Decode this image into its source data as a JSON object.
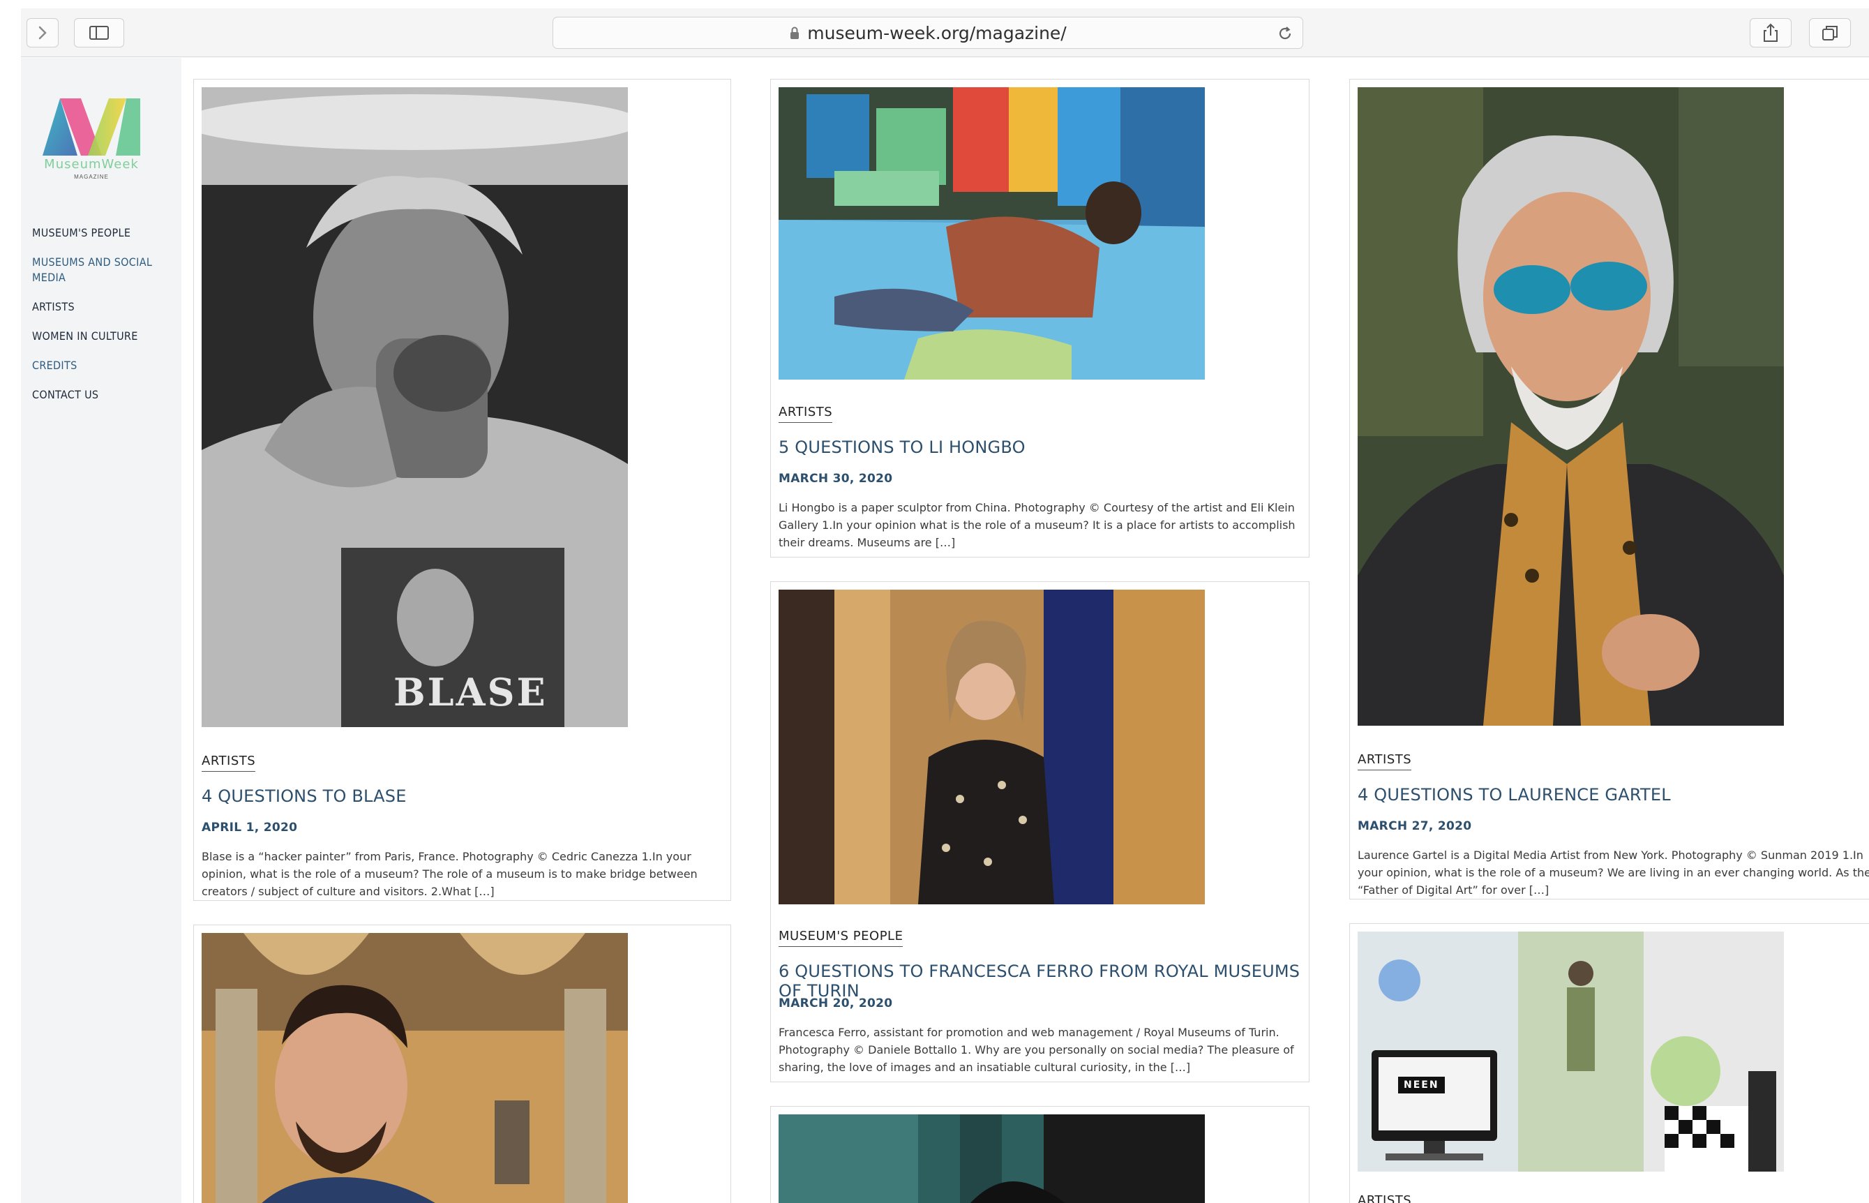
{
  "browser": {
    "url": "museum-week.org/magazine/"
  },
  "sidebar": {
    "logo_text": "MuseumWeek",
    "logo_sub": "MAGAZINE",
    "nav": [
      {
        "label": "MUSEUM'S PEOPLE"
      },
      {
        "label": "MUSEUMS AND SOCIAL MEDIA"
      },
      {
        "label": "ARTISTS"
      },
      {
        "label": "WOMEN IN CULTURE"
      },
      {
        "label": "CREDITS"
      },
      {
        "label": "CONTACT US"
      }
    ]
  },
  "posts": [
    {
      "category": "ARTISTS",
      "title": "4 QUESTIONS TO BLASE",
      "date": "APRIL 1, 2020",
      "excerpt": "Blase is a “hacker painter” from Paris, France. Photography © Cedric Canezza 1.In your opinion, what is the role of a museum? The role of a museum is to make bridge between creators / subject of culture and visitors. 2.What […]",
      "image_text": "BLASE"
    },
    {
      "category": "ARTISTS",
      "title": "5 QUESTIONS TO LI HONGBO",
      "date": "MARCH 30, 2020",
      "excerpt": "Li Hongbo is a paper sculptor from China. Photography © Courtesy of the artist and Eli Klein Gallery 1.In your opinion what is the role of a museum? It is a place for artists to accomplish their dreams. Museums are […]"
    },
    {
      "category": "MUSEUM'S PEOPLE",
      "title": "6 QUESTIONS TO FRANCESCA FERRO FROM ROYAL MUSEUMS OF TURIN",
      "date": "MARCH 20, 2020",
      "excerpt": "Francesca Ferro, assistant for promotion and web management / Royal Museums of Turin. Photography © Daniele Bottallo 1. Why are you personally on social media? The pleasure of sharing, the love of images and an insatiable cultural curiosity, in the […]"
    },
    {
      "category": "ARTISTS",
      "title": "4 QUESTIONS TO LAURENCE GARTEL",
      "date": "MARCH 27, 2020",
      "excerpt": "Laurence Gartel is a Digital Media Artist from New York. Photography © Sunman 2019 1.In your opinion, what is the role of a museum? We are living in an ever changing world. As the “Father of Digital Art” for over […]"
    },
    {
      "category": "ARTISTS",
      "image_text": "NEEN"
    }
  ],
  "colors": {
    "title_blue": "#2c4f6e",
    "sidebar_bg": "#f3f4f5"
  }
}
